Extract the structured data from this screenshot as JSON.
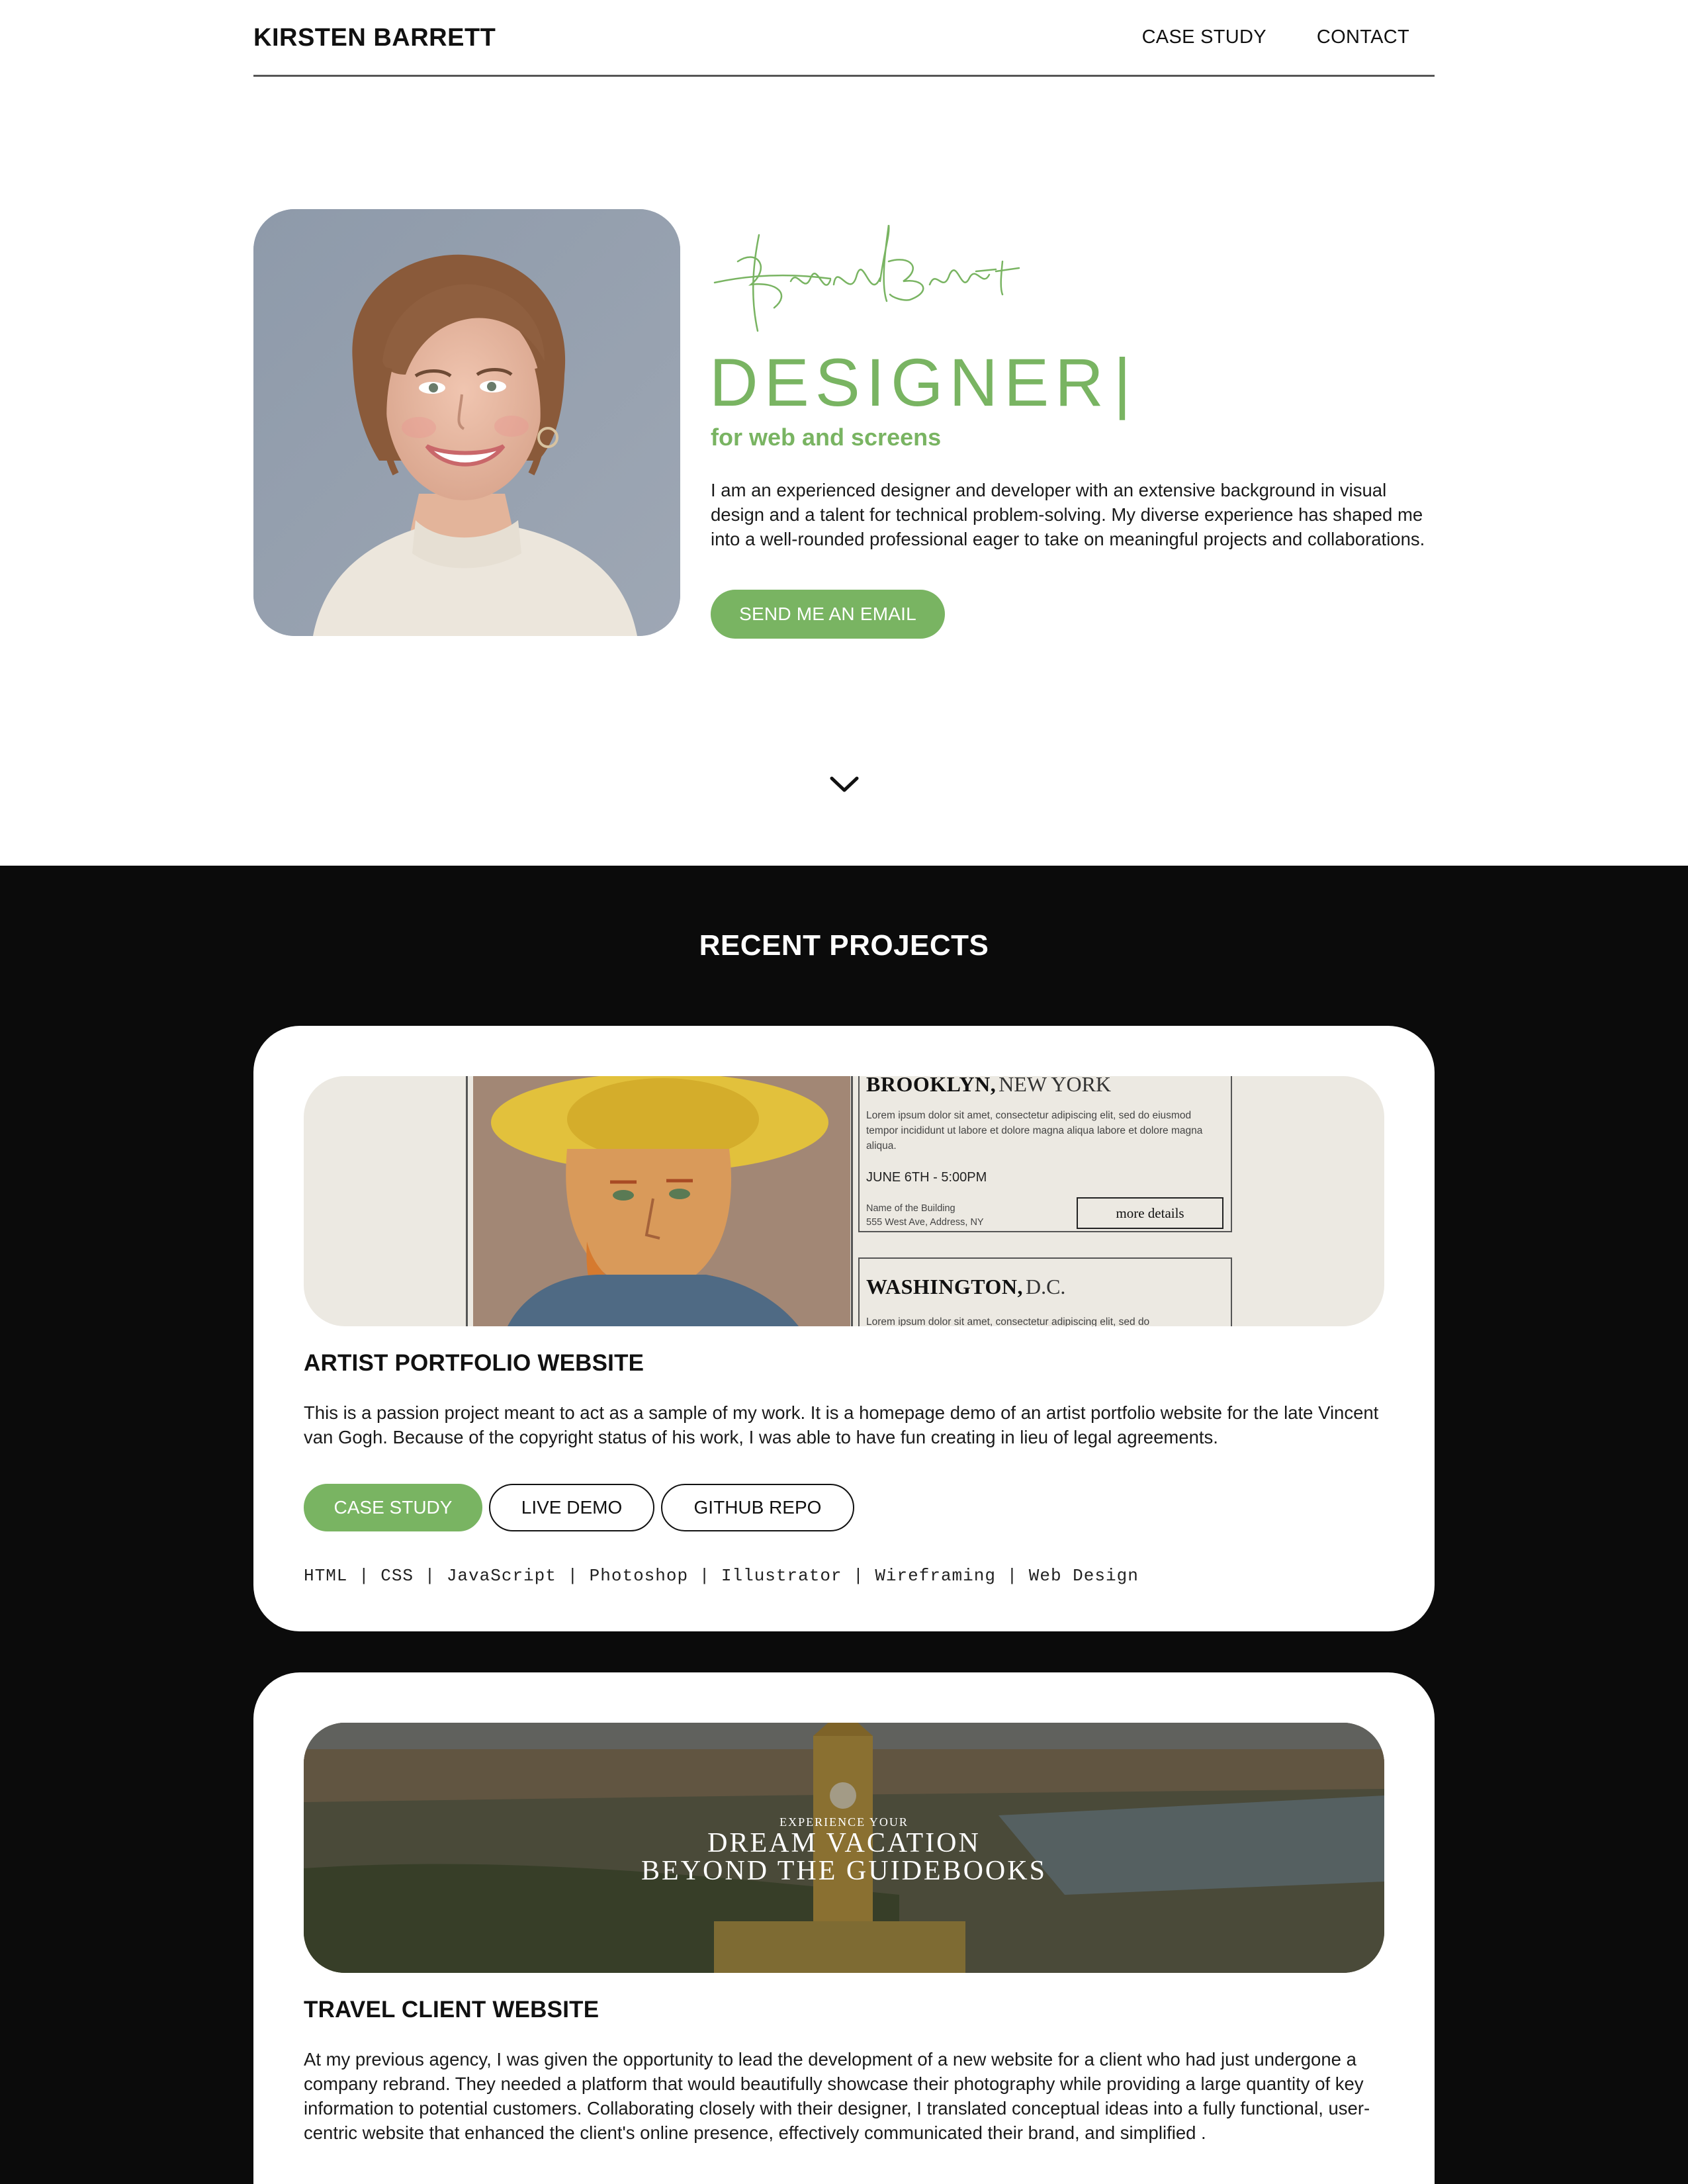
{
  "header": {
    "brand": "KIRSTEN BARRETT",
    "nav": [
      "CASE STUDY",
      "CONTACT"
    ]
  },
  "hero": {
    "signature": "Kirsten Barrett",
    "headline": "DESIGNER",
    "cursor": "|",
    "subheadline": "for web and screens",
    "bio": "I am an experienced designer and developer with an extensive background in visual design and a talent for technical problem-solving. My diverse experience has shaped me into a well-rounded professional eager to take on meaningful projects and collaborations.",
    "cta_label": "SEND ME AN EMAIL",
    "scroll_icon": "chevron-down-icon"
  },
  "projects": {
    "section_title": "RECENT PROJECTS",
    "items": [
      {
        "title": "ARTIST PORTFOLIO WEBSITE",
        "description": "This is a passion project meant to act as a sample of my work. It is a homepage demo of an artist portfolio website for the late Vincent van Gogh. Because of the copyright status of his work, I was able to have fun creating in lieu of legal agreements.",
        "buttons": [
          "CASE STUDY",
          "LIVE DEMO",
          "GITHUB REPO"
        ],
        "tech": "HTML | CSS | JavaScript | Photoshop | Illustrator | Wireframing | Web Design",
        "thumbnail": {
          "event_1": {
            "city": "BROOKLYN,",
            "region": "NEW YORK",
            "lorem": "Lorem ipsum dolor sit amet, consectetur adipiscing elit, sed do eiusmod tempor incididunt ut labore et dolore magna aliqua labore et dolore magna aliqua.",
            "date": "JUNE 6TH - 5:00PM",
            "venue": "Name of the Building",
            "address": "555 West Ave, Address, NY",
            "more": "more details"
          },
          "event_2": {
            "city": "WASHINGTON,",
            "region": "D.C.",
            "lorem": "Lorem ipsum dolor sit amet, consectetur adipiscing elit, sed do"
          }
        }
      },
      {
        "title": "TRAVEL CLIENT WEBSITE",
        "description": "At my previous agency, I was given the opportunity to lead the development of a new website for a client who had just undergone a company rebrand. They needed a platform that would beautifully showcase their photography while providing a large quantity of key information to potential customers. Collaborating closely with their designer, I translated conceptual ideas into a fully functional, user-centric website that enhanced the client's online presence, effectively communicated their brand, and simplified .",
        "thumbnail": {
          "kicker": "EXPERIENCE YOUR",
          "line_1": "DREAM VACATION",
          "line_2": "BEYOND THE GUIDEBOOKS"
        }
      }
    ]
  },
  "colors": {
    "accent": "#79b462",
    "dark_section": "#0b0b0b",
    "card_bg": "#ffffff"
  }
}
